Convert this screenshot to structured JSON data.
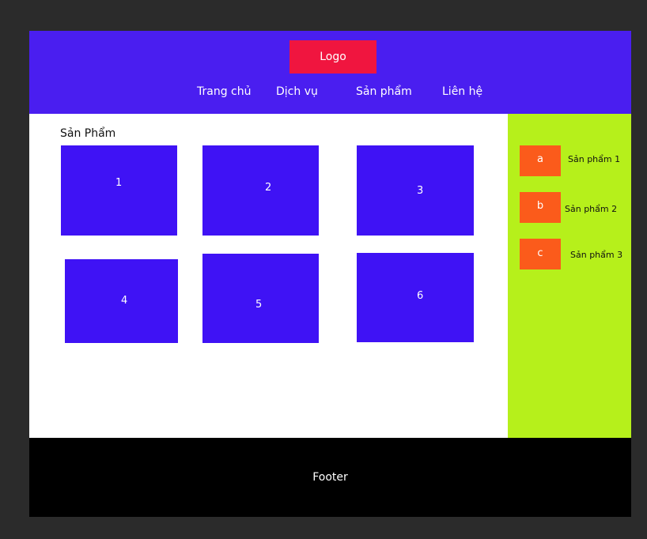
{
  "header": {
    "logo": "Logo",
    "nav": [
      {
        "label": "Trang chủ"
      },
      {
        "label": "Dịch vụ"
      },
      {
        "label": "Sản phẩm"
      },
      {
        "label": "Liên hệ"
      }
    ]
  },
  "main": {
    "title": "Sản Phẩm",
    "products": [
      {
        "label": "1"
      },
      {
        "label": "2"
      },
      {
        "label": "3"
      },
      {
        "label": "4"
      },
      {
        "label": "5"
      },
      {
        "label": "6"
      }
    ]
  },
  "sidebar": {
    "items": [
      {
        "badge": "a",
        "label": "Sản phẩm 1"
      },
      {
        "badge": "b",
        "label": "Sản phẩm 2"
      },
      {
        "badge": "c",
        "label": "Sản phẩm 3"
      }
    ]
  },
  "footer": {
    "text": "Footer"
  },
  "colors": {
    "page_background": "#2b2b2b",
    "header": "#4a1ef0",
    "logo": "#f0153f",
    "product_box": "#3f12f5",
    "sidebar": "#b6f01b",
    "sidebar_thumb": "#fb5b1b",
    "footer": "#000000"
  }
}
